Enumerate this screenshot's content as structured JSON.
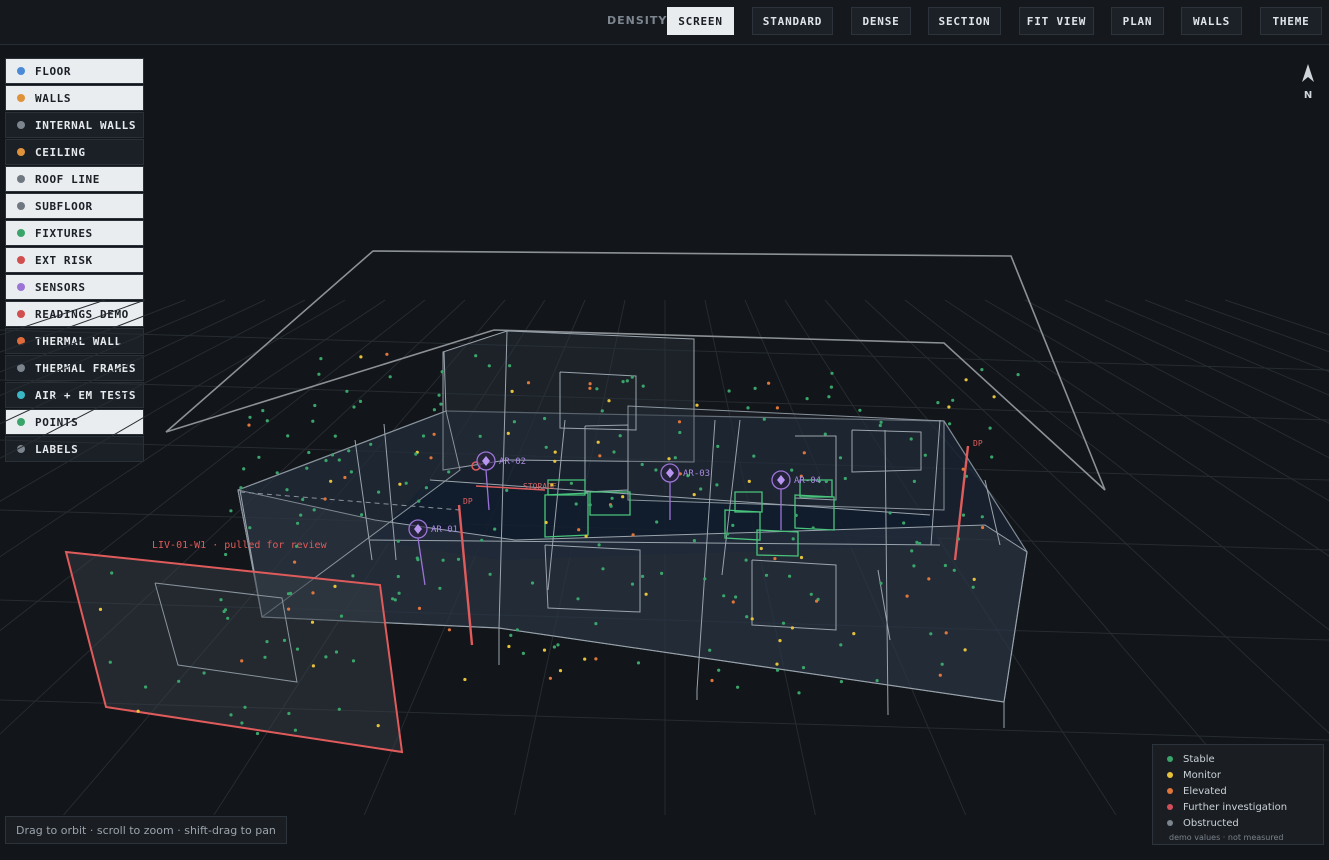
{
  "toolbar": {
    "density_label": "DENSITY",
    "buttons": [
      "SCREEN",
      "STANDARD",
      "DENSE",
      "SECTION",
      "FIT VIEW",
      "PLAN",
      "WALLS",
      "THEME"
    ],
    "active": "SCREEN"
  },
  "layers": [
    {
      "label": "FLOOR",
      "color": "#4a8ad6",
      "on": true
    },
    {
      "label": "WALLS",
      "color": "#e0923a",
      "on": true
    },
    {
      "label": "INTERNAL WALLS",
      "color": "#7c848d",
      "on": false
    },
    {
      "label": "CEILING",
      "color": "#e0923a",
      "on": false
    },
    {
      "label": "ROOF LINE",
      "color": "#6f7780",
      "on": true
    },
    {
      "label": "SUBFLOOR",
      "color": "#6f7780",
      "on": true
    },
    {
      "label": "FIXTURES",
      "color": "#3aa56a",
      "on": true
    },
    {
      "label": "EXT RISK",
      "color": "#d24f4f",
      "on": true
    },
    {
      "label": "SENSORS",
      "color": "#9b74d6",
      "on": true
    },
    {
      "label": "READINGS DEMO",
      "color": "#d24f4f",
      "on": true
    },
    {
      "label": "THERMAL WALL",
      "color": "#e06b3a",
      "on": false
    },
    {
      "label": "THERMAL FRAMES",
      "color": "#7c848d",
      "on": false
    },
    {
      "label": "AIR + EM TESTS",
      "color": "#3ab7c6",
      "on": false
    },
    {
      "label": "POINTS",
      "color": "#3aa56a",
      "on": true
    },
    {
      "label": "LABELS",
      "color": "#7c848d",
      "on": false
    }
  ],
  "compass": {
    "label": "N"
  },
  "scene": {
    "sensors": [
      "AR-01",
      "AR-02",
      "AR-03",
      "AR-04"
    ],
    "dp_label": "DP",
    "dp_label_2": "DP",
    "storage_label": "STORAGE",
    "flag_label": "LIV-01-W1 · pulled for review"
  },
  "legend": {
    "items": [
      {
        "label": "Stable",
        "color": "#3aa56a"
      },
      {
        "label": "Monitor",
        "color": "#e6c23a"
      },
      {
        "label": "Elevated",
        "color": "#e0763a"
      },
      {
        "label": "Further investigation",
        "color": "#d24f5a"
      },
      {
        "label": "Obstructed",
        "color": "#7c848d"
      }
    ],
    "note": "demo values · not measured"
  },
  "hint": "Drag to orbit · scroll to zoom · shift-drag to pan"
}
